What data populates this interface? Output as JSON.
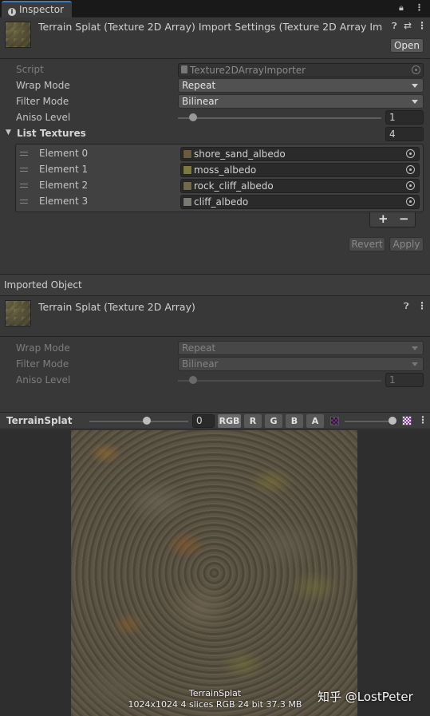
{
  "window": {
    "tab_label": "Inspector",
    "icons": [
      "lock-icon",
      "menu-kebab-icon"
    ]
  },
  "header": {
    "title": "Terrain Splat (Texture 2D Array) Import Settings (Texture 2D Array Im",
    "open_label": "Open"
  },
  "importer": {
    "script_label": "Script",
    "script_value": "Texture2DArrayImporter",
    "wrap_label": "Wrap Mode",
    "wrap_value": "Repeat",
    "filter_label": "Filter Mode",
    "filter_value": "Bilinear",
    "aniso_label": "Aniso Level",
    "aniso_value": "1",
    "aniso_level": 1,
    "list_label": "List Textures",
    "list_count": "4",
    "elements": [
      {
        "label": "Element 0",
        "value": "shore_sand_albedo",
        "swatch": "#6b5a3e"
      },
      {
        "label": "Element 1",
        "value": "moss_albedo",
        "swatch": "#7c7a3c"
      },
      {
        "label": "Element 2",
        "value": "rock_cliff_albedo",
        "swatch": "#6e6a4a"
      },
      {
        "label": "Element 3",
        "value": "cliff_albedo",
        "swatch": "#7a7a72"
      }
    ],
    "plus": "+",
    "minus": "−",
    "revert_label": "Revert",
    "apply_label": "Apply"
  },
  "imported": {
    "section_label": "Imported Object",
    "title": "Terrain Splat (Texture 2D Array)",
    "wrap_label": "Wrap Mode",
    "wrap_value": "Repeat",
    "filter_label": "Filter Mode",
    "filter_value": "Bilinear",
    "aniso_label": "Aniso Level",
    "aniso_value": "1"
  },
  "preview": {
    "name": "TerrainSplat",
    "slice_value": "0",
    "channels": [
      "RGB",
      "R",
      "G",
      "B",
      "A"
    ],
    "caption_name": "TerrainSplat",
    "caption_info": "1024x1024 4 slices RGB 24 bit 37.3 MB",
    "watermark": "知乎 @LostPeter"
  },
  "colors": {
    "accent": "#3a79bb",
    "panel": "#383838",
    "field": "#2a2a2a"
  }
}
